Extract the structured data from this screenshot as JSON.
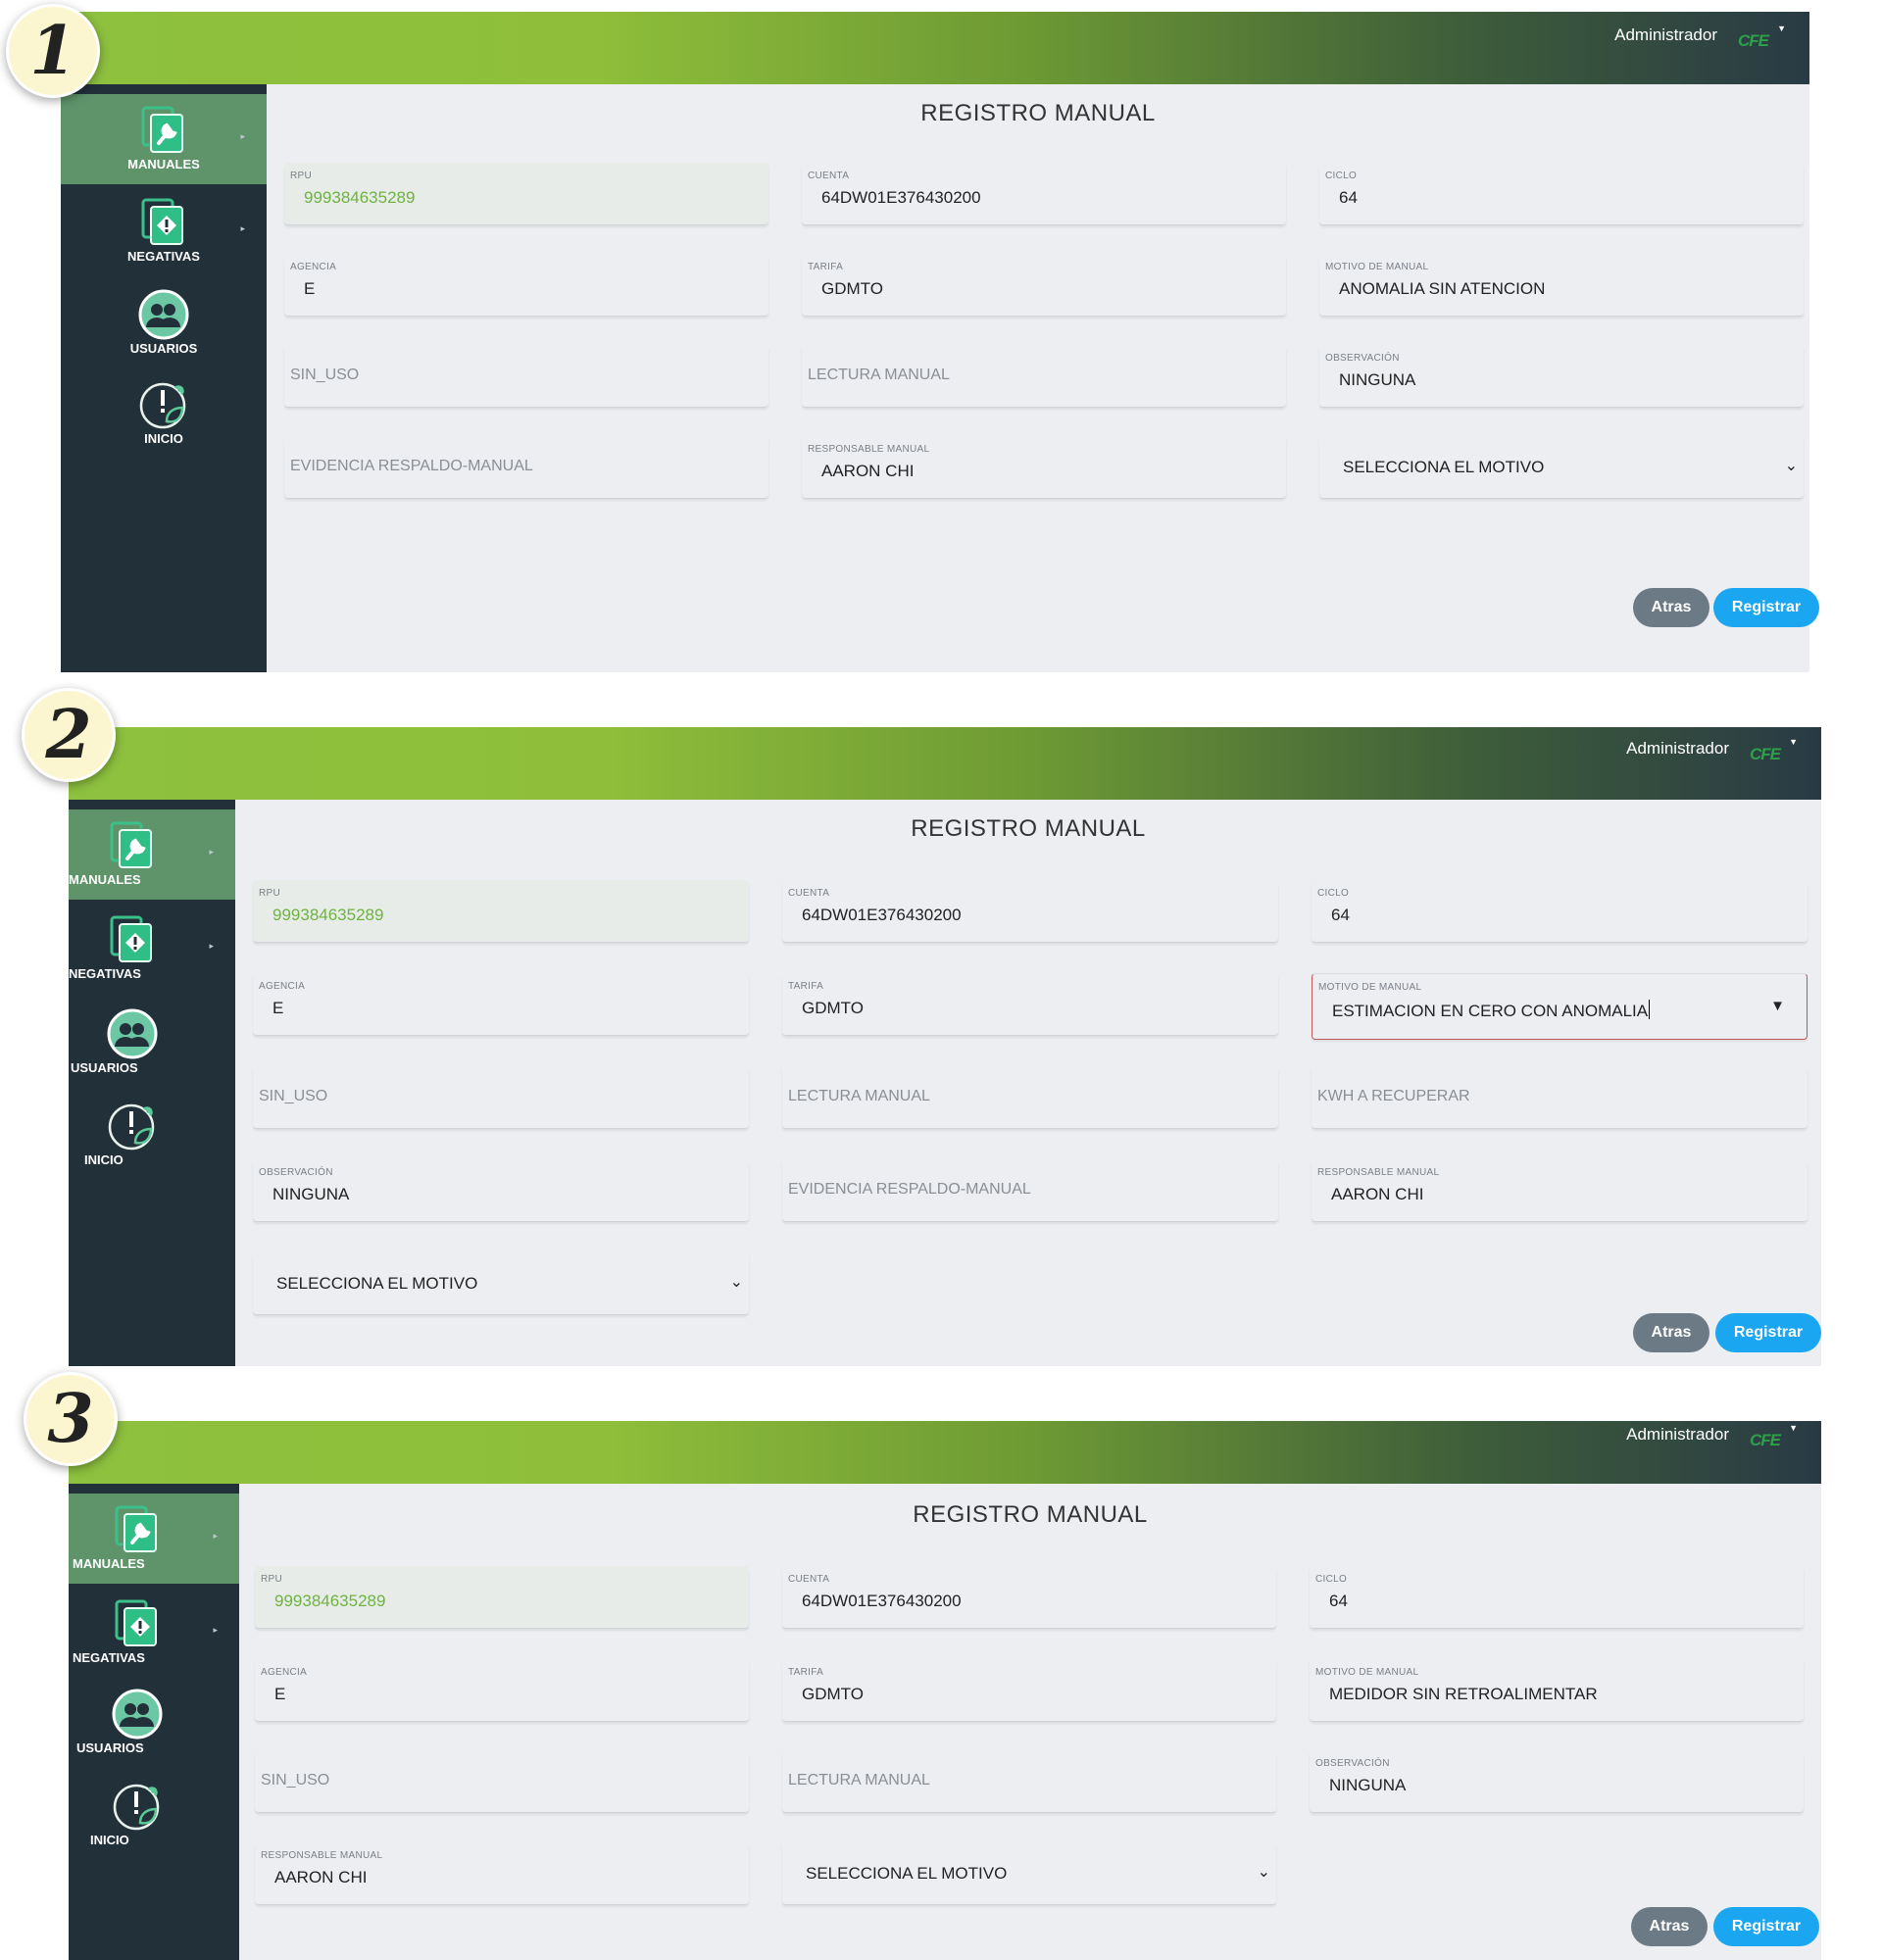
{
  "header": {
    "user": "Administrador",
    "logo": "CFE"
  },
  "sidebar": {
    "items": [
      {
        "label": "MANUALES",
        "icon": "wrench-document-icon"
      },
      {
        "label": "NEGATIVAS",
        "icon": "warning-document-icon"
      },
      {
        "label": "USUARIOS",
        "icon": "users-icon"
      },
      {
        "label": "INICIO",
        "icon": "leaf-alert-icon"
      }
    ]
  },
  "buttons": {
    "back": "Atras",
    "register": "Registrar"
  },
  "panels": [
    {
      "number": "1",
      "title": "REGISTRO MANUAL",
      "fields": {
        "rpu": {
          "label": "RPU",
          "value": "999384635289"
        },
        "cuenta": {
          "label": "CUENTA",
          "value": "64DW01E376430200"
        },
        "ciclo": {
          "label": "CICLO",
          "value": "64"
        },
        "agencia": {
          "label": "AGENCIA",
          "value": "E"
        },
        "tarifa": {
          "label": "TARIFA",
          "value": "GDMTO"
        },
        "motivo": {
          "label": "MOTIVO DE MANUAL",
          "value": "ANOMALIA SIN ATENCION"
        },
        "sin_uso": {
          "placeholder": "SIN_USO"
        },
        "lectura": {
          "placeholder": "LECTURA MANUAL"
        },
        "observacion": {
          "label": "OBSERVACIÓN",
          "value": "NINGUNA"
        },
        "evidencia": {
          "placeholder": "EVIDENCIA RESPALDO-MANUAL"
        },
        "responsable": {
          "label": "RESPONSABLE MANUAL",
          "value": "AARON CHI"
        },
        "selecciona": {
          "value": "SELECCIONA EL MOTIVO"
        }
      }
    },
    {
      "number": "2",
      "title": "REGISTRO MANUAL",
      "fields": {
        "rpu": {
          "label": "RPU",
          "value": "999384635289"
        },
        "cuenta": {
          "label": "CUENTA",
          "value": "64DW01E376430200"
        },
        "ciclo": {
          "label": "CICLO",
          "value": "64"
        },
        "agencia": {
          "label": "AGENCIA",
          "value": "E"
        },
        "tarifa": {
          "label": "TARIFA",
          "value": "GDMTO"
        },
        "motivo": {
          "label": "MOTIVO DE MANUAL",
          "value": "ESTIMACION EN CERO CON ANOMALIA"
        },
        "sin_uso": {
          "placeholder": "SIN_USO"
        },
        "lectura": {
          "placeholder": "LECTURA MANUAL"
        },
        "kwh": {
          "placeholder": "KWH A RECUPERAR"
        },
        "observacion": {
          "label": "OBSERVACIÓN",
          "value": "NINGUNA"
        },
        "evidencia": {
          "placeholder": "EVIDENCIA RESPALDO-MANUAL"
        },
        "responsable": {
          "label": "RESPONSABLE MANUAL",
          "value": "AARON CHI"
        },
        "selecciona": {
          "value": "SELECCIONA EL MOTIVO"
        }
      }
    },
    {
      "number": "3",
      "title": "REGISTRO MANUAL",
      "fields": {
        "rpu": {
          "label": "RPU",
          "value": "999384635289"
        },
        "cuenta": {
          "label": "CUENTA",
          "value": "64DW01E376430200"
        },
        "ciclo": {
          "label": "CICLO",
          "value": "64"
        },
        "agencia": {
          "label": "AGENCIA",
          "value": "E"
        },
        "tarifa": {
          "label": "TARIFA",
          "value": "GDMTO"
        },
        "motivo": {
          "label": "MOTIVO DE MANUAL",
          "value": "MEDIDOR SIN RETROALIMENTAR"
        },
        "sin_uso": {
          "placeholder": "SIN_USO"
        },
        "lectura": {
          "placeholder": "LECTURA MANUAL"
        },
        "observacion": {
          "label": "OBSERVACIÓN",
          "value": "NINGUNA"
        },
        "responsable": {
          "label": "RESPONSABLE MANUAL",
          "value": "AARON CHI"
        },
        "selecciona": {
          "value": "SELECCIONA EL MOTIVO"
        }
      }
    }
  ]
}
